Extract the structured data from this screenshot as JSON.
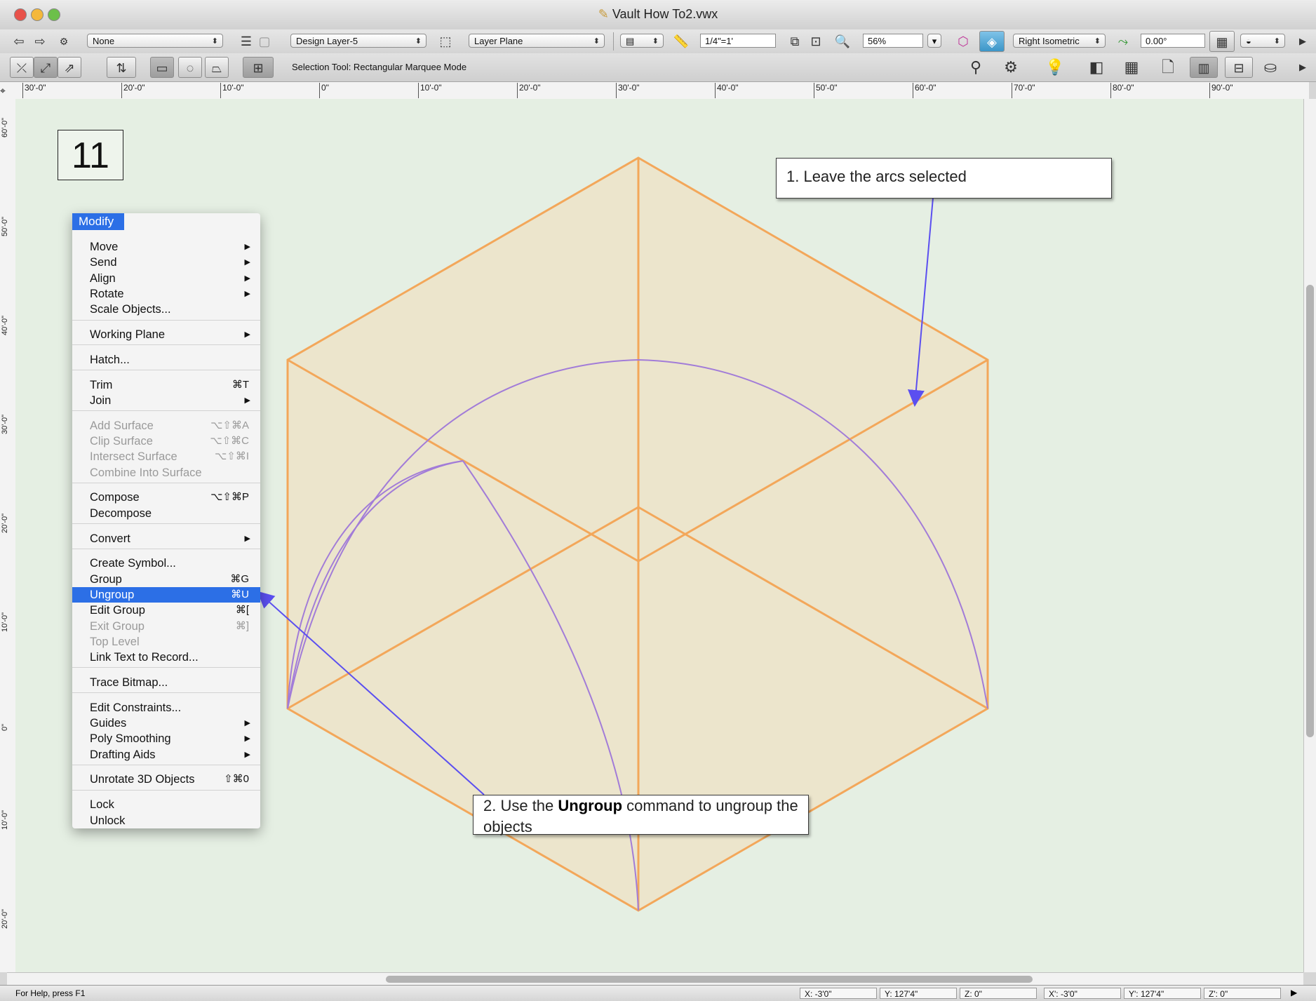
{
  "window": {
    "title": "Vault How To2.vwx"
  },
  "toolbar1": {
    "class_popup": "None",
    "layer_popup": "Design Layer-5",
    "plane_popup": "Layer Plane",
    "scale_field": "1/4\"=1'",
    "zoom_field": "56%",
    "view_popup": "Right Isometric",
    "angle_field": "0.00°"
  },
  "toolbar2": {
    "tool_mode_text": "Selection Tool: Rectangular Marquee Mode"
  },
  "ruler": {
    "h_labels": [
      "30'-0\"",
      "20'-0\"",
      "10'-0\"",
      "0\"",
      "10'-0\"",
      "20'-0\"",
      "30'-0\"",
      "40'-0\"",
      "50'-0\"",
      "60'-0\"",
      "70'-0\"",
      "80'-0\"",
      "90'-0\""
    ],
    "v_labels": [
      "60'-0\"",
      "50'-0\"",
      "40'-0\"",
      "30'-0\"",
      "20'-0\"",
      "10'-0\"",
      "0\"",
      "10'-0\"",
      "20'-0\""
    ]
  },
  "step_number": "11",
  "menu": {
    "title": "Modify",
    "items": [
      {
        "label": "Move",
        "shortcut": "",
        "submenu": true,
        "disabled": false
      },
      {
        "label": "Send",
        "shortcut": "",
        "submenu": true,
        "disabled": false
      },
      {
        "label": "Align",
        "shortcut": "",
        "submenu": true,
        "disabled": false
      },
      {
        "label": "Rotate",
        "shortcut": "",
        "submenu": true,
        "disabled": false
      },
      {
        "label": "Scale Objects...",
        "shortcut": "",
        "submenu": false,
        "disabled": false
      },
      {
        "label": "Working Plane",
        "shortcut": "",
        "submenu": true,
        "disabled": false
      },
      {
        "label": "Hatch...",
        "shortcut": "",
        "submenu": false,
        "disabled": false
      },
      {
        "label": "Trim",
        "shortcut": "⌘T",
        "submenu": false,
        "disabled": false
      },
      {
        "label": "Join",
        "shortcut": "",
        "submenu": true,
        "disabled": false
      },
      {
        "label": "Add Surface",
        "shortcut": "⌥⇧⌘A",
        "submenu": false,
        "disabled": true
      },
      {
        "label": "Clip Surface",
        "shortcut": "⌥⇧⌘C",
        "submenu": false,
        "disabled": true
      },
      {
        "label": "Intersect Surface",
        "shortcut": "⌥⇧⌘I",
        "submenu": false,
        "disabled": true
      },
      {
        "label": "Combine Into Surface",
        "shortcut": "",
        "submenu": false,
        "disabled": true
      },
      {
        "label": "Compose",
        "shortcut": "⌥⇧⌘P",
        "submenu": false,
        "disabled": false
      },
      {
        "label": "Decompose",
        "shortcut": "",
        "submenu": false,
        "disabled": false
      },
      {
        "label": "Convert",
        "shortcut": "",
        "submenu": true,
        "disabled": false
      },
      {
        "label": "Create Symbol...",
        "shortcut": "",
        "submenu": false,
        "disabled": false
      },
      {
        "label": "Group",
        "shortcut": "⌘G",
        "submenu": false,
        "disabled": false
      },
      {
        "label": "Ungroup",
        "shortcut": "⌘U",
        "submenu": false,
        "disabled": false,
        "highlighted": true
      },
      {
        "label": "Edit Group",
        "shortcut": "⌘[",
        "submenu": false,
        "disabled": false
      },
      {
        "label": "Exit Group",
        "shortcut": "⌘]",
        "submenu": false,
        "disabled": true
      },
      {
        "label": "Top Level",
        "shortcut": "",
        "submenu": false,
        "disabled": true
      },
      {
        "label": "Link Text to Record...",
        "shortcut": "",
        "submenu": false,
        "disabled": false
      },
      {
        "label": "Trace Bitmap...",
        "shortcut": "",
        "submenu": false,
        "disabled": false
      },
      {
        "label": "Edit Constraints...",
        "shortcut": "",
        "submenu": false,
        "disabled": false
      },
      {
        "label": "Guides",
        "shortcut": "",
        "submenu": true,
        "disabled": false
      },
      {
        "label": "Poly Smoothing",
        "shortcut": "",
        "submenu": true,
        "disabled": false
      },
      {
        "label": "Drafting Aids",
        "shortcut": "",
        "submenu": true,
        "disabled": false
      },
      {
        "label": "Unrotate 3D Objects",
        "shortcut": "⇧⌘0",
        "submenu": false,
        "disabled": false
      },
      {
        "label": "Lock",
        "shortcut": "",
        "submenu": false,
        "disabled": false
      },
      {
        "label": "Unlock",
        "shortcut": "",
        "submenu": false,
        "disabled": false
      }
    ]
  },
  "callouts": {
    "c1": "1. Leave the arcs selected",
    "c2_prefix": "2. Use the ",
    "c2_bold": "Ungroup",
    "c2_suffix": " command to ungroup the objects"
  },
  "status": {
    "help": "For Help, press F1",
    "x": "X:  -3'0\"",
    "y": "Y:  127'4\"",
    "z": "Z:  0\"",
    "xp": "X':  -3'0\"",
    "yp": "Y':  127'4\"",
    "zp": "Z':  0\""
  },
  "colors": {
    "box_edge": "#f3a75a",
    "box_fill": "#ede2c4",
    "arc": "#a27cd8",
    "arrow": "#5b4ff0",
    "highlight": "#2c6fe6"
  }
}
